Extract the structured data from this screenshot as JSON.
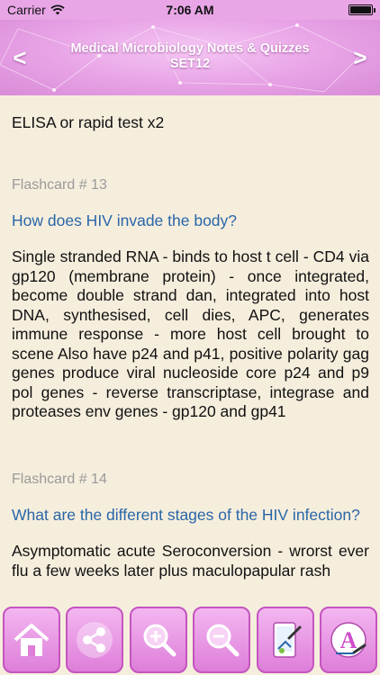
{
  "status_bar": {
    "carrier": "Carrier",
    "time": "7:06 AM",
    "battery_level": 1.0
  },
  "header": {
    "title_line1": "Medical Microbiology  Notes & Quizzes",
    "title_line2": "SET12",
    "prev_label": "<",
    "next_label": ">",
    "background_color": "#e7a2e5"
  },
  "content": {
    "prev_tail": "ELISA or rapid test x2",
    "cards": [
      {
        "number_label": "Flashcard # 13",
        "question": "How does HIV invade the body?",
        "answer": "Single stranded RNA - binds to host t cell - CD4 via gp120 (membrane protein) - once integrated, become double strand dan, integrated into host DNA, synthesised, cell dies, APC, generates immune response - more host cell brought to scene Also have p24 and p41, positive polarity gag genes produce viral nucleoside core p24 and p9 pol genes - reverse transcriptase, integrase and proteases env genes - gp120 and gp41"
      },
      {
        "number_label": "Flashcard # 14",
        "question": "What are the different stages of the HIV infection?",
        "answer": "Asymptomatic acute Seroconversion - wrorst ever flu a few weeks later plus maculopapular rash"
      }
    ],
    "question_color": "#2a66a8"
  },
  "toolbar": {
    "icons": [
      "home-icon",
      "share-icon",
      "zoom-in-icon",
      "zoom-out-icon",
      "theme-icon",
      "font-icon"
    ],
    "button_color": "#de7ed9"
  }
}
